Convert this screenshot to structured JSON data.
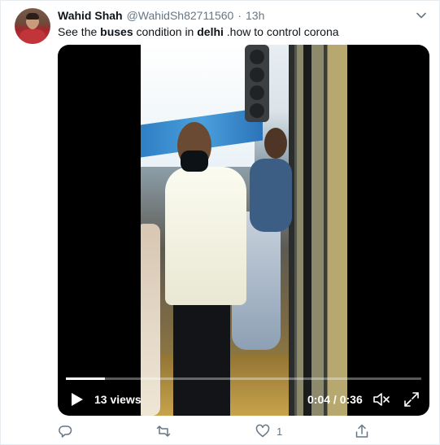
{
  "author": {
    "name": "Wahid Shah",
    "handle": "@WahidSh82711560",
    "separator": "·",
    "time": "13h"
  },
  "tweet": {
    "text_parts": [
      "See the ",
      "buses",
      " condition in ",
      "delhi",
      " .how to control corona"
    ]
  },
  "video": {
    "views": "13 views",
    "current_time": "0:04",
    "time_separator": "/",
    "duration": "0:36",
    "progress_fraction": 0.11
  },
  "actions": {
    "reply_count": "",
    "retweet_count": "",
    "like_count": "1",
    "share_count": ""
  },
  "icons": {
    "caret": "chevron-down-icon",
    "play": "play-icon",
    "volume": "volume-muted-icon",
    "fullscreen": "fullscreen-icon",
    "reply": "reply-icon",
    "retweet": "retweet-icon",
    "like": "heart-icon",
    "share": "share-icon"
  },
  "colors": {
    "secondary_text": "#657786",
    "primary_text": "#0f1419",
    "video_background": "#000000"
  }
}
